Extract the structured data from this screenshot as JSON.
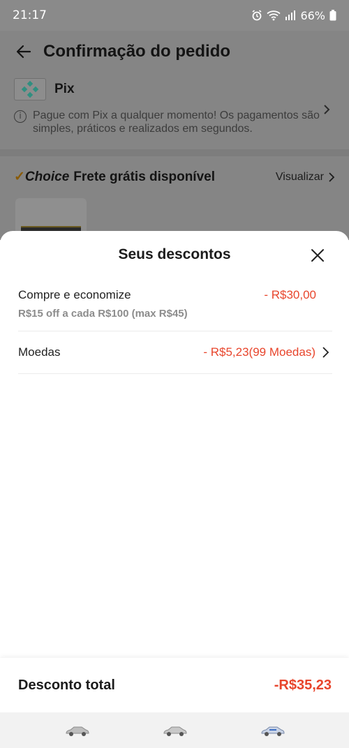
{
  "status": {
    "time": "21:17",
    "battery": "66%"
  },
  "header": {
    "title": "Confirmação do pedido"
  },
  "payment": {
    "method": "Pix",
    "note": "Pague com Pix a qualquer momento! Os pagamentos são simples, práticos e realizados em segundos."
  },
  "shipping": {
    "check": "✓",
    "brand": "Choice",
    "text": "Frete grátis disponível",
    "action": "Visualizar"
  },
  "sheet": {
    "title": "Seus descontos",
    "discounts": [
      {
        "label": "Compre e economize",
        "detail": "R$15 off a cada R$100 (max R$45)",
        "value": "- R$30,00"
      },
      {
        "label": "Moedas",
        "value": "- R$5,23(99 Moedas)"
      }
    ],
    "total_label": "Desconto total",
    "total_value": "-R$35,23"
  },
  "colors": {
    "accent": "#e8452c",
    "overlay": "#858585",
    "pix": "#4cb6a6"
  },
  "icons": [
    "back-arrow-icon",
    "pix-icon",
    "info-icon",
    "chevron-right-icon",
    "close-icon",
    "alarm-icon",
    "wifi-icon",
    "signal-icon",
    "battery-icon",
    "car-icon"
  ]
}
